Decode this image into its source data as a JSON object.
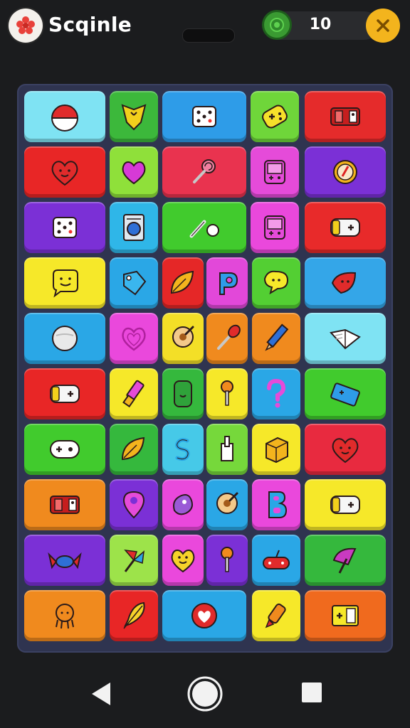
{
  "header": {
    "title": "Scqinle",
    "score": "10",
    "logo_icon": "flower-icon",
    "coin_icon": "coin-icon",
    "close_icon": "close-icon"
  },
  "colors": {
    "background": "#1b1c1e",
    "board": "#2f3450",
    "accent_close": "#f3b41d",
    "coin": "#3a9a32"
  },
  "board": {
    "rows": [
      [
        {
          "color": "#7fe3f3",
          "icon": "pokeball-icon"
        },
        {
          "color": "#3cb83b",
          "icon": "shield-heart-icon"
        },
        {
          "color": "#2e9ce8",
          "icon": "dice-icon"
        },
        {
          "color": "#6fd63a",
          "icon": "gamepad-icon"
        },
        {
          "color": "#e52b2b",
          "icon": "console-icon"
        }
      ],
      [
        {
          "color": "#e82626",
          "icon": "heart-face-icon"
        },
        {
          "color": "#8fe03a",
          "icon": "heart-icon"
        },
        {
          "color": "#e9334f",
          "icon": "lollipop-icon"
        },
        {
          "color": "#e54bd9",
          "icon": "handheld-icon"
        },
        {
          "color": "#7b30d6",
          "icon": "badge-icon"
        }
      ],
      [
        {
          "color": "#7b30d6",
          "icon": "dice-icon"
        },
        {
          "color": "#2fb6e8",
          "icon": "washer-icon"
        },
        {
          "color": "#41cb2d",
          "icon": "pencil-cloud-icon"
        },
        {
          "color": "#ea48dc",
          "icon": "handheld-icon"
        },
        {
          "color": "#e82a2a",
          "icon": "controller-icon"
        }
      ],
      [
        {
          "color": "#f6e829",
          "icon": "chat-smile-icon"
        },
        {
          "color": "#2aa7e6",
          "icon": "tag-heart-icon"
        },
        {
          "color": "#e52727",
          "icon": "leaf-icon"
        },
        {
          "color": "#e248d9",
          "icon": "letter-p-icon"
        },
        {
          "color": "#53cf33",
          "icon": "chat-icon"
        },
        {
          "color": "#34a6e8",
          "icon": "leaf-face-icon"
        }
      ],
      [
        {
          "color": "#2aa7e6",
          "icon": "ball-icon"
        },
        {
          "color": "#ea48dc",
          "icon": "heart-outline-icon"
        },
        {
          "color": "#f3df27",
          "icon": "pin-icon"
        },
        {
          "color": "#f08a1e",
          "icon": "match-icon"
        },
        {
          "color": "#f08a1e",
          "icon": "pencil-icon"
        },
        {
          "color": "#7fe3f3",
          "icon": "book-icon"
        }
      ],
      [
        {
          "color": "#e82626",
          "icon": "controller-icon"
        },
        {
          "color": "#f6e829",
          "icon": "lipstick-icon"
        },
        {
          "color": "#35b83d",
          "icon": "phone-icon"
        },
        {
          "color": "#f6e829",
          "icon": "key-icon"
        },
        {
          "color": "#2aa7e6",
          "icon": "question-icon"
        },
        {
          "color": "#41cb2d",
          "icon": "tablet-icon"
        }
      ],
      [
        {
          "color": "#41cb2d",
          "icon": "chat-gamepad-icon"
        },
        {
          "color": "#35b83d",
          "icon": "leaf-icon"
        },
        {
          "color": "#46c9e8",
          "icon": "letter-s-icon"
        },
        {
          "color": "#76d83b",
          "icon": "hand-icon"
        },
        {
          "color": "#f6e829",
          "icon": "cube-icon"
        },
        {
          "color": "#e82a3f",
          "icon": "heart-face-icon"
        }
      ],
      [
        {
          "color": "#f08a1e",
          "icon": "console-icon"
        },
        {
          "color": "#7b30d6",
          "icon": "location-icon"
        },
        {
          "color": "#ea48dc",
          "icon": "blob-icon"
        },
        {
          "color": "#2aa7e6",
          "icon": "pin-icon"
        },
        {
          "color": "#ea48dc",
          "icon": "letter-b-icon"
        },
        {
          "color": "#f6e829",
          "icon": "controller-icon"
        }
      ],
      [
        {
          "color": "#7b30d6",
          "icon": "candy-icon"
        },
        {
          "color": "#9de34a",
          "icon": "pinwheel-icon"
        },
        {
          "color": "#ea48dc",
          "icon": "heart-smile-icon"
        },
        {
          "color": "#7b30d6",
          "icon": "key-icon"
        },
        {
          "color": "#2aa7e6",
          "icon": "joystick-icon"
        },
        {
          "color": "#35b83d",
          "icon": "umbrella-icon"
        }
      ],
      [
        {
          "color": "#f08a1e",
          "icon": "octopus-icon"
        },
        {
          "color": "#e82626",
          "icon": "feather-icon"
        },
        {
          "color": "#2aa7e6",
          "icon": "heart-badge-icon"
        },
        {
          "color": "#f6e829",
          "icon": "rocket-icon"
        },
        {
          "color": "#f06a1e",
          "icon": "card-icon"
        }
      ]
    ]
  },
  "nav": {
    "back_icon": "back-triangle-icon",
    "home_icon": "home-circle-icon",
    "recents_icon": "recents-square-icon"
  }
}
